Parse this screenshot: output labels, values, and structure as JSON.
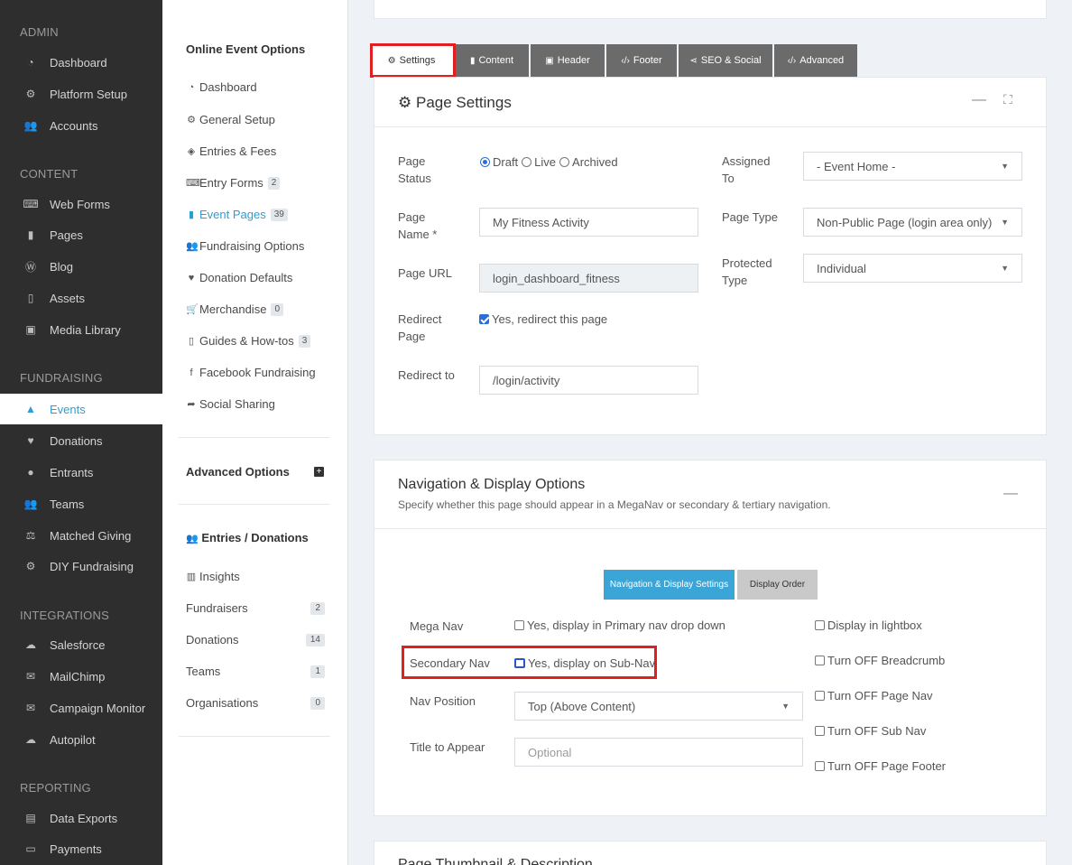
{
  "sidebar": {
    "sections": [
      {
        "label": "ADMIN"
      },
      {
        "label": "CONTENT"
      },
      {
        "label": "FUNDRAISING"
      },
      {
        "label": "INTEGRATIONS"
      },
      {
        "label": "REPORTING"
      }
    ],
    "items": [
      {
        "label": "Dashboard",
        "icon": "dashboard-icon"
      },
      {
        "label": "Platform Setup",
        "icon": "gears-icon"
      },
      {
        "label": "Accounts",
        "icon": "users-icon"
      },
      {
        "label": "Web Forms",
        "icon": "keyboard-icon"
      },
      {
        "label": "Pages",
        "icon": "file-icon"
      },
      {
        "label": "Blog",
        "icon": "wordpress-icon"
      },
      {
        "label": "Assets",
        "icon": "file-pdf-icon"
      },
      {
        "label": "Media Library",
        "icon": "image-icon"
      },
      {
        "label": "Events",
        "icon": "road-icon"
      },
      {
        "label": "Donations",
        "icon": "heart-icon"
      },
      {
        "label": "Entrants",
        "icon": "user-icon"
      },
      {
        "label": "Teams",
        "icon": "users-icon"
      },
      {
        "label": "Matched Giving",
        "icon": "balance-scale-icon"
      },
      {
        "label": "DIY Fundraising",
        "icon": "gear-icon"
      },
      {
        "label": "Salesforce",
        "icon": "cloud-icon"
      },
      {
        "label": "MailChimp",
        "icon": "envelope-icon"
      },
      {
        "label": "Campaign Monitor",
        "icon": "envelope-icon"
      },
      {
        "label": "Autopilot",
        "icon": "cloud-icon"
      },
      {
        "label": "Data Exports",
        "icon": "file-excel-icon"
      },
      {
        "label": "Payments",
        "icon": "money-icon"
      }
    ]
  },
  "subpanel": {
    "online_title": "Online Event Options",
    "items": [
      {
        "label": "Dashboard",
        "icon": "dashboard-icon",
        "badge": ""
      },
      {
        "label": "General Setup",
        "icon": "gear-icon",
        "badge": ""
      },
      {
        "label": "Entries & Fees",
        "icon": "tag-icon",
        "badge": ""
      },
      {
        "label": "Entry Forms",
        "icon": "keyboard-icon",
        "badge": "2"
      },
      {
        "label": "Event Pages",
        "icon": "file-icon",
        "badge": "39"
      },
      {
        "label": "Fundraising Options",
        "icon": "users-icon",
        "badge": ""
      },
      {
        "label": "Donation Defaults",
        "icon": "heart-icon",
        "badge": ""
      },
      {
        "label": "Merchandise",
        "icon": "cart-icon",
        "badge": "0"
      },
      {
        "label": "Guides & How-tos",
        "icon": "file-pdf-icon",
        "badge": "3"
      },
      {
        "label": "Facebook Fundraising",
        "icon": "facebook-icon",
        "badge": ""
      },
      {
        "label": "Social Sharing",
        "icon": "share-icon",
        "badge": ""
      }
    ],
    "advanced_title": "Advanced Options",
    "entries_title": "Entries / Donations",
    "entries": [
      {
        "label": "Insights",
        "badge": ""
      },
      {
        "label": "Fundraisers",
        "badge": "2"
      },
      {
        "label": "Donations",
        "badge": "14"
      },
      {
        "label": "Teams",
        "badge": "1"
      },
      {
        "label": "Organisations",
        "badge": "0"
      }
    ]
  },
  "tabs": [
    {
      "label": "Settings",
      "icon": "gear-icon"
    },
    {
      "label": "Content",
      "icon": "file-icon"
    },
    {
      "label": "Header",
      "icon": "image-icon"
    },
    {
      "label": "Footer",
      "icon": "code-icon"
    },
    {
      "label": "SEO & Social",
      "icon": "share-alt-icon"
    },
    {
      "label": "Advanced",
      "icon": "code-icon"
    }
  ],
  "page_settings": {
    "title": "Page Settings",
    "status_label": "Page Status",
    "status_options": [
      "Draft",
      "Live",
      "Archived"
    ],
    "status_selected": "Draft",
    "name_label": "Page Name *",
    "name_value": "My Fitness Activity",
    "url_label": "Page URL",
    "url_value": "login_dashboard_fitness",
    "redirect_label": "Redirect Page",
    "redirect_check": "Yes, redirect this page",
    "redirect_to_label": "Redirect to",
    "redirect_to_value": "/login/activity",
    "assigned_label": "Assigned To",
    "assigned_value": "- Event Home -",
    "type_label": "Page Type",
    "type_value": "Non-Public Page (login area only)",
    "protected_label": "Protected Type",
    "protected_value": "Individual"
  },
  "nav_options": {
    "title": "Navigation & Display Options",
    "description": "Specify whether this page should appear in a MegaNav or secondary & tertiary navigation.",
    "btn_settings": "Navigation & Display Settings",
    "btn_order": "Display Order",
    "mega_label": "Mega Nav",
    "mega_check": "Yes, display in Primary nav drop down",
    "secondary_label": "Secondary Nav",
    "secondary_check": "Yes, display on Sub-Nav",
    "position_label": "Nav Position",
    "position_value": "Top (Above Content)",
    "title_label": "Title to Appear",
    "title_placeholder": "Optional",
    "right_checks": [
      "Display in lightbox",
      "Turn OFF Breadcrumb",
      "Turn OFF Page Nav",
      "Turn OFF Sub Nav",
      "Turn OFF Page Footer"
    ]
  },
  "thumbnail": {
    "title": "Page Thumbnail & Description"
  }
}
